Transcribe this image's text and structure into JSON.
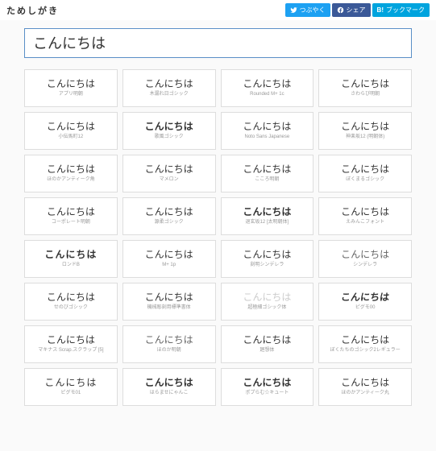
{
  "header": {
    "logo": "ためしがき",
    "social": {
      "twitter": "つぶやく",
      "facebook": "シェア",
      "hatena": "ブックマーク"
    }
  },
  "input": {
    "value": "こんにちは"
  },
  "fonts": [
    {
      "sample": "こんにちは",
      "name": "アプリ明朝",
      "cls": "ser"
    },
    {
      "sample": "こんにちは",
      "name": "木漏れ日ゴシック",
      "cls": ""
    },
    {
      "sample": "こんにちは",
      "name": "Rounded M+ 1c",
      "cls": ""
    },
    {
      "sample": "こんにちは",
      "name": "さわらび明朝",
      "cls": "ser"
    },
    {
      "sample": "こんにちは",
      "name": "小伝馬町12",
      "cls": ""
    },
    {
      "sample": "こんにちは",
      "name": "歌風ゴシック",
      "cls": "w-bold"
    },
    {
      "sample": "こんにちは",
      "name": "Noto Sans Japanese",
      "cls": ""
    },
    {
      "sample": "こんにちは",
      "name": "神楽坂12 (明朝体)",
      "cls": "ser"
    },
    {
      "sample": "こんにちは",
      "name": "ほのかアンティーク角",
      "cls": ""
    },
    {
      "sample": "こんにちは",
      "name": "マメロン",
      "cls": ""
    },
    {
      "sample": "こんにちは",
      "name": "こころ明朝",
      "cls": "ser"
    },
    {
      "sample": "こんにちは",
      "name": "ぼくまるゴシック",
      "cls": ""
    },
    {
      "sample": "こんにちは",
      "name": "コーポレート明朝",
      "cls": "ser"
    },
    {
      "sample": "こんにちは",
      "name": "源柔ゴシック",
      "cls": ""
    },
    {
      "sample": "こんにちは",
      "name": "退玄坂12 [太明朝体]",
      "cls": "ser w-bold"
    },
    {
      "sample": "こんにちは",
      "name": "えみんこフォント",
      "cls": ""
    },
    {
      "sample": "こんにちは",
      "name": "ロンドB",
      "cls": "w-medium spaced"
    },
    {
      "sample": "こんにちは",
      "name": "M+ 1p",
      "cls": ""
    },
    {
      "sample": "こんにちは",
      "name": "刻明シンデレラ",
      "cls": "ser"
    },
    {
      "sample": "こんにちは",
      "name": "シンデレラ",
      "cls": "w-light"
    },
    {
      "sample": "こんにちは",
      "name": "せのびゴシック",
      "cls": ""
    },
    {
      "sample": "こんにちは",
      "name": "機械彫刻用標準書体",
      "cls": ""
    },
    {
      "sample": "こんにちは",
      "name": "超極細ゴシック体",
      "cls": "faint w-light"
    },
    {
      "sample": "こんにちは",
      "name": "ピグモ00",
      "cls": "w-bold italicish"
    },
    {
      "sample": "こんにちは",
      "name": "マキナス Scrap.スクラップ [5]",
      "cls": ""
    },
    {
      "sample": "こんにちは",
      "name": "ほのか明朝",
      "cls": "ser w-light"
    },
    {
      "sample": "こんにちは",
      "name": "廻想体",
      "cls": ""
    },
    {
      "sample": "こんにちは",
      "name": "ぼくたちのゴシック2レギュラー",
      "cls": ""
    },
    {
      "sample": "こんにちは",
      "name": "ピグモ01",
      "cls": "spaced"
    },
    {
      "sample": "こんにちは",
      "name": "はらませにゃんこ",
      "cls": "w-bold"
    },
    {
      "sample": "こんにちは",
      "name": "ポプらむ☆キュート",
      "cls": "w-bold"
    },
    {
      "sample": "こんにちは",
      "name": "ほのかアンティーク丸",
      "cls": ""
    }
  ]
}
